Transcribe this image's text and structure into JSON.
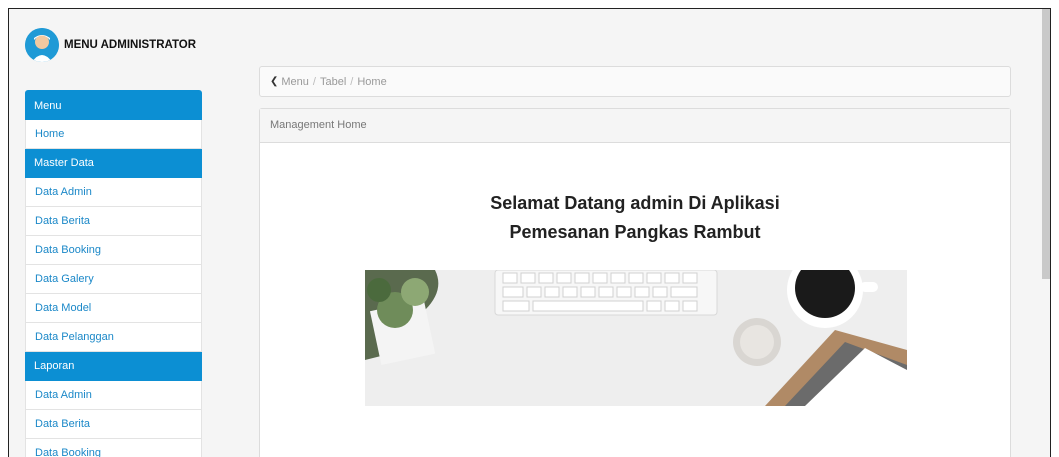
{
  "brand": {
    "title": "MENU ADMINISTRATOR"
  },
  "sidebar": {
    "sections": [
      {
        "heading": "Menu",
        "items": [
          "Home"
        ]
      },
      {
        "heading": "Master Data",
        "items": [
          "Data Admin",
          "Data Berita",
          "Data Booking",
          "Data Galery",
          "Data Model",
          "Data Pelanggan"
        ]
      },
      {
        "heading": "Laporan",
        "items": [
          "Data Admin",
          "Data Berita",
          "Data Booking"
        ]
      }
    ]
  },
  "breadcrumb": {
    "items": [
      "Menu",
      "Tabel",
      "Home"
    ],
    "separator": "/"
  },
  "panel": {
    "title": "Management Home",
    "welcome_line1": "Selamat Datang admin Di Aplikasi",
    "welcome_line2": "Pemesanan Pangkas Rambut"
  },
  "colors": {
    "accent": "#0c8fd3",
    "link": "#1b88c8",
    "background": "#f5f5f5"
  }
}
